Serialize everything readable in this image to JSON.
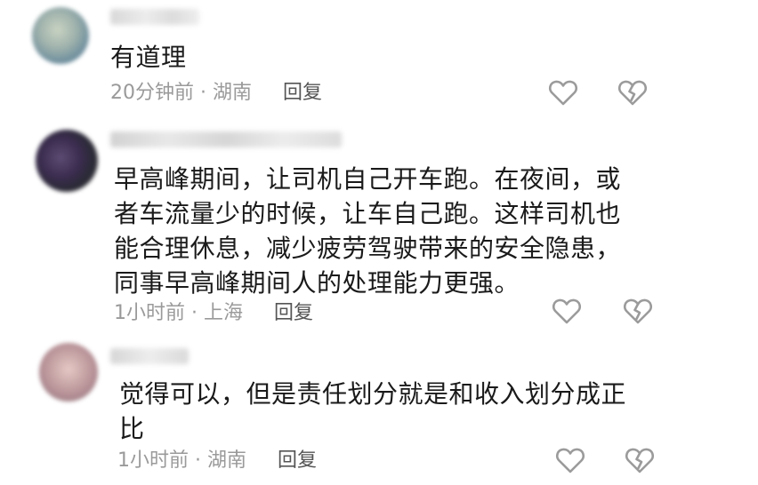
{
  "comments": [
    {
      "content": "有道理",
      "time": "20分钟前",
      "location": "湖南",
      "reply_label": "回复",
      "like_icon": "heart-outline-icon",
      "dislike_icon": "broken-heart-icon"
    },
    {
      "content": "早高峰期间，让司机自己开车跑。在夜间，或\n者车流量少的时候，让车自己跑。这样司机也\n能合理休息，减少疲劳驾驶带来的安全隐患，\n同事早高峰期间人的处理能力更强。",
      "time": "1小时前",
      "location": "上海",
      "reply_label": "回复",
      "like_icon": "heart-outline-icon",
      "dislike_icon": "broken-heart-icon"
    },
    {
      "content": "觉得可以，但是责任划分就是和收入划分成正\n比",
      "time": "1小时前",
      "location": "湖南",
      "reply_label": "回复",
      "like_icon": "heart-outline-icon",
      "dislike_icon": "broken-heart-icon"
    }
  ],
  "meta_separator": "·",
  "colors": {
    "text": "#1a1a1a",
    "meta": "#9a9a9a",
    "icon_stroke": "#9b9b9b"
  }
}
